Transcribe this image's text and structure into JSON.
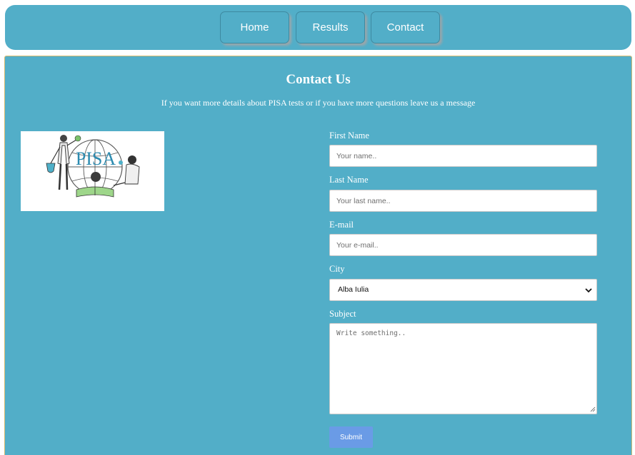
{
  "nav": {
    "items": [
      {
        "label": "Home"
      },
      {
        "label": "Results"
      },
      {
        "label": "Contact"
      }
    ]
  },
  "contact": {
    "title": "Contact Us",
    "subtitle": "If you want more details about PISA tests or if you have more questions leave us a message",
    "logo_text": "PISA"
  },
  "form": {
    "first_name": {
      "label": "First Name",
      "placeholder": "Your name.."
    },
    "last_name": {
      "label": "Last Name",
      "placeholder": "Your last name.."
    },
    "email": {
      "label": "E-mail",
      "placeholder": "Your e-mail.."
    },
    "city": {
      "label": "City",
      "value": "Alba Iulia"
    },
    "subject": {
      "label": "Subject",
      "placeholder": "Write something.."
    },
    "submit_label": "Submit"
  },
  "colors": {
    "background": "#52aec8",
    "submit_button": "#6a9be6",
    "text": "#ffffff"
  }
}
